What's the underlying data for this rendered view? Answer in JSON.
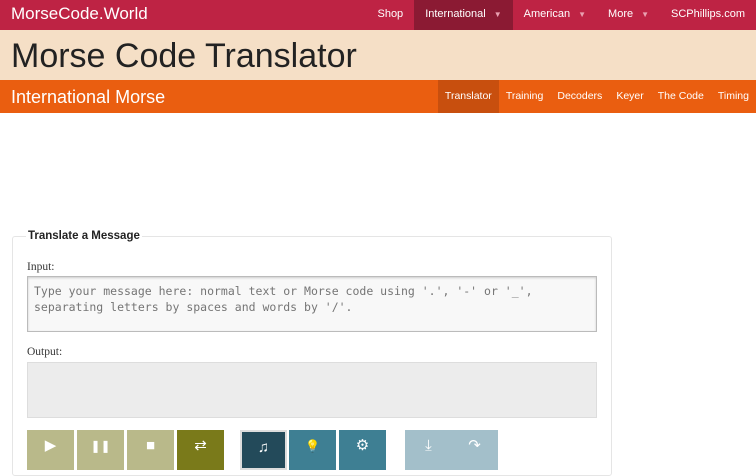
{
  "topbar": {
    "brand": "MorseCode.World",
    "nav": [
      "Shop",
      "International",
      "American",
      "More",
      "SCPhillips.com"
    ]
  },
  "header": {
    "title": "Morse Code Translator"
  },
  "subheader": {
    "title": "International Morse",
    "nav": [
      "Translator",
      "Training",
      "Decoders",
      "Keyer",
      "The Code",
      "Timing"
    ]
  },
  "form": {
    "legend": "Translate a Message",
    "input_label": "Input:",
    "input_placeholder": "Type your message here: normal text or Morse code using '.', '-' or '_', separating letters by spaces and words by '/'.",
    "output_label": "Output:"
  },
  "buttons": [
    {
      "icon": "▶"
    },
    {
      "icon": "❚❚"
    },
    {
      "icon": "■"
    },
    {
      "icon": "⇄"
    },
    {
      "icon": "♫"
    },
    {
      "icon": "💡"
    },
    {
      "icon": "⚙"
    },
    {
      "icon": "⤓"
    },
    {
      "icon": "↷"
    }
  ]
}
